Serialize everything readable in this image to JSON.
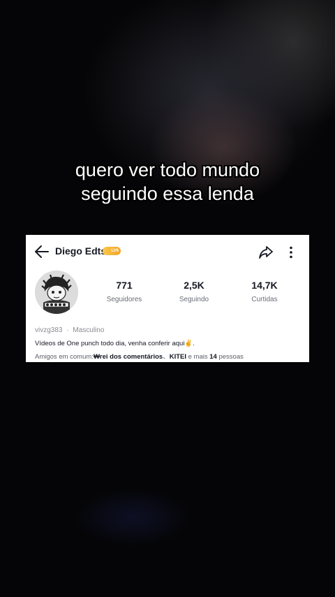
{
  "caption": {
    "line1": "quero ver todo mundo",
    "line2": "seguindo essa lenda"
  },
  "profile": {
    "name": "Diego Edts",
    "badge_label": "LV6",
    "stats": [
      {
        "value": "771",
        "label": "Seguidores"
      },
      {
        "value": "2,5K",
        "label": "Seguindo"
      },
      {
        "value": "14,7K",
        "label": "Curtidas"
      }
    ],
    "username": "vivzg383",
    "separator": "·",
    "gender": "Masculino",
    "bio": "Vídeos de One punch todo dia, venha conferir aqui✌️.",
    "mutual": {
      "prefix": "Amigos em comum:",
      "friend1": "₩rei dos comentários",
      "sep": "、",
      "friend2": "KITEI",
      "more_text": " e mais ",
      "count": "14",
      "suffix": " pessoas"
    }
  },
  "icons": {
    "back": "back-arrow-icon",
    "share": "share-icon",
    "more": "more-icon"
  },
  "colors": {
    "badge": "#f3a42a",
    "card_bg": "#ffffff"
  }
}
